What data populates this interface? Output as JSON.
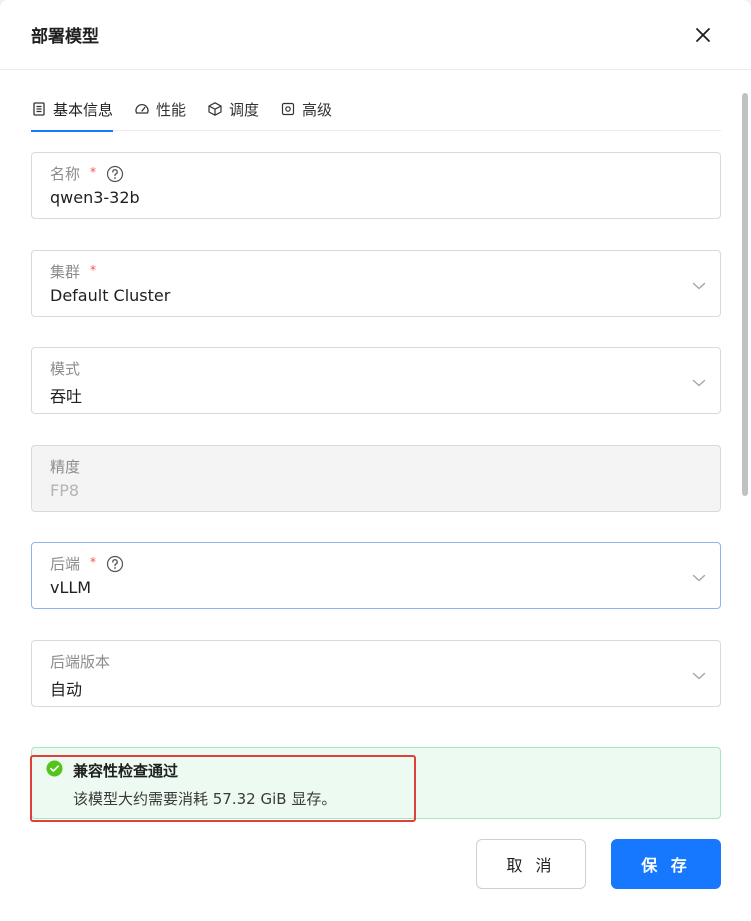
{
  "modal": {
    "title": "部署模型"
  },
  "tabs": [
    {
      "label": "基本信息",
      "icon": "form-icon",
      "active": true
    },
    {
      "label": "性能",
      "icon": "gauge-icon",
      "active": false
    },
    {
      "label": "调度",
      "icon": "cube-icon",
      "active": false
    },
    {
      "label": "高级",
      "icon": "settings-icon",
      "active": false
    }
  ],
  "fields": {
    "name": {
      "label": "名称",
      "required_mark": "*",
      "value": "qwen3-32b"
    },
    "cluster": {
      "label": "集群",
      "required_mark": "*",
      "value": "Default Cluster"
    },
    "mode": {
      "label": "模式",
      "value": "吞吐"
    },
    "precision": {
      "label": "精度",
      "value": "FP8"
    },
    "backend": {
      "label": "后端",
      "required_mark": "*",
      "value": "vLLM"
    },
    "backend_version": {
      "label": "后端版本",
      "value": "自动"
    }
  },
  "alert": {
    "title": "兼容性检查通过",
    "description": "该模型大约需要消耗 57.32 GiB 显存。",
    "color": "#52c41a"
  },
  "buttons": {
    "cancel": "取 消",
    "save": "保 存"
  },
  "colors": {
    "primary": "#1677ff",
    "required": "#ff4d4f",
    "highlight": "#e0403a"
  }
}
